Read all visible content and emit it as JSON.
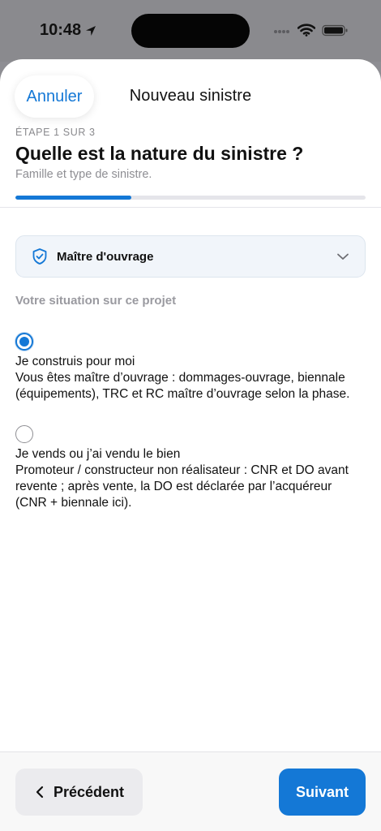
{
  "status_bar": {
    "time": "10:48",
    "icons": [
      "location-arrow-icon",
      "signal-icon",
      "wifi-icon",
      "battery-icon"
    ]
  },
  "nav": {
    "cancel_label": "Annuler",
    "title": "Nouveau sinistre"
  },
  "header": {
    "step_label": "ÉTAPE 1 SUR 3",
    "title": "Quelle est la nature du sinistre ?",
    "subtitle": "Famille et type de sinistre.",
    "progress": 0.33
  },
  "role_select": {
    "icon": "shield-check-icon",
    "selected_value": "Maître d'ouvrage"
  },
  "situation": {
    "label": "Votre situation sur ce projet",
    "options": [
      {
        "selected": true,
        "title": "Je construis pour moi",
        "description": "Vous êtes maître d’ouvrage : dommages-ouvrage, biennale (équipements), TRC et RC maître d’ouvrage selon la phase."
      },
      {
        "selected": false,
        "title": "Je vends ou j’ai vendu le bien",
        "description": "Promoteur / constructeur non réalisateur : CNR et DO avant revente ; après vente, la DO est déclarée par l’acquéreur (CNR + biennale ici)."
      }
    ]
  },
  "footer": {
    "prev_label": "Précédent",
    "next_label": "Suivant"
  },
  "colors": {
    "accent": "#1478d6",
    "select_background": "#f1f5fa",
    "secondary_text": "#8e8e93"
  }
}
